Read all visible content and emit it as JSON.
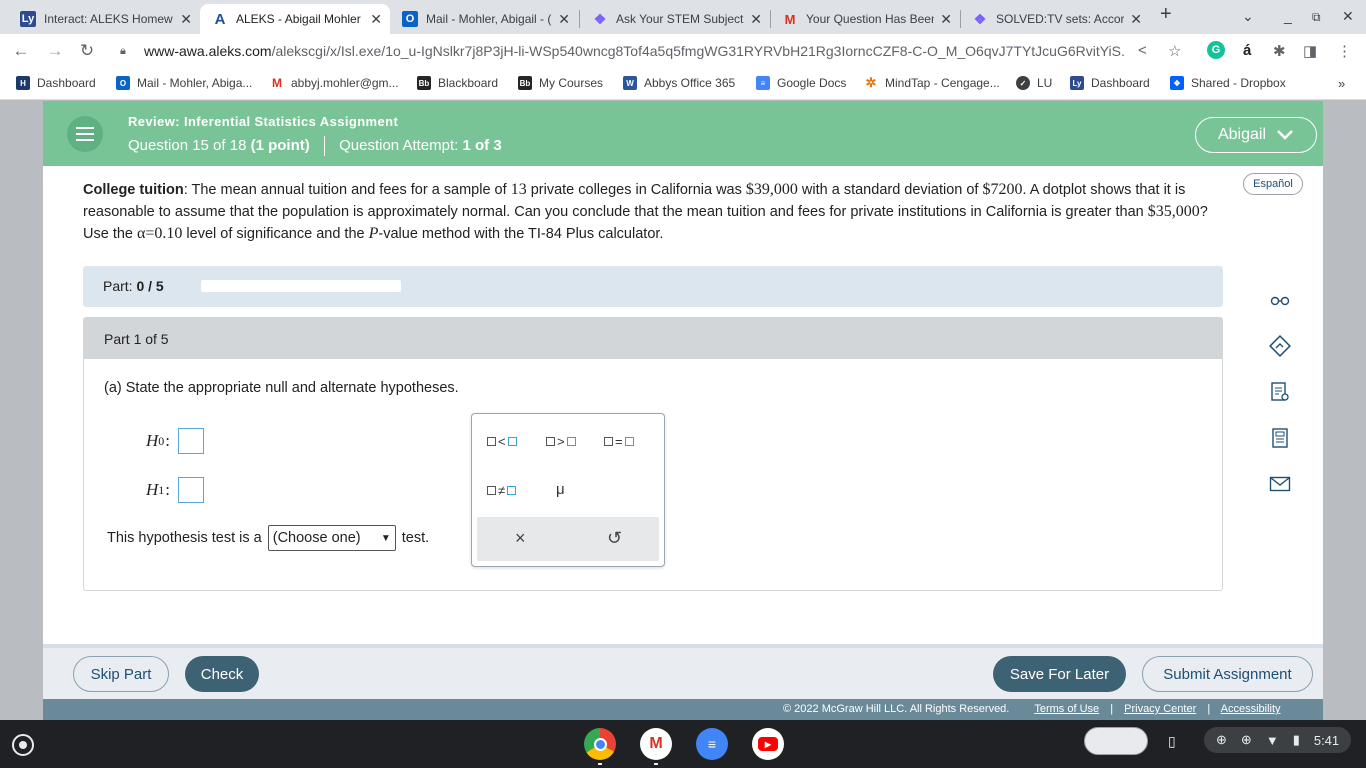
{
  "tabs": [
    {
      "title": "Interact: ALEKS Homew",
      "icon": "aleks-tab-icon"
    },
    {
      "title": "ALEKS - Abigail Mohler",
      "icon": "aleks-a-icon"
    },
    {
      "title": "Mail - Mohler, Abigail - (",
      "icon": "outlook-icon"
    },
    {
      "title": "Ask Your STEM Subject",
      "icon": "chegg-icon"
    },
    {
      "title": "Your Question Has Been",
      "icon": "gmail-icon"
    },
    {
      "title": "SOLVED:TV sets: Accor",
      "icon": "chegg-icon"
    }
  ],
  "url": {
    "host": "www-awa.aleks.com",
    "path": "/alekscgi/x/Isl.exe/1o_u-IgNslkr7j8P3jH-li-WSp540wncg8Tof4a5q5fmgWG31RYRVbH21Rg3IorncCZF8-C-O_M_O6qvJ7TYtJcuG6RvitYiS..."
  },
  "bookmarks": [
    {
      "label": "Dashboard",
      "icon": "dashboard-icon"
    },
    {
      "label": "Mail - Mohler, Abiga...",
      "icon": "outlook-icon"
    },
    {
      "label": "abbyj.mohler@gm...",
      "icon": "gmail-icon"
    },
    {
      "label": "Blackboard",
      "icon": "blackboard-icon"
    },
    {
      "label": "My Courses",
      "icon": "blackboard-icon"
    },
    {
      "label": "Abbys Office 365",
      "icon": "word-icon"
    },
    {
      "label": "Google Docs",
      "icon": "docs-icon"
    },
    {
      "label": "MindTap - Cengage...",
      "icon": "mindtap-icon"
    },
    {
      "label": "LU",
      "icon": "lu-icon"
    },
    {
      "label": "Dashboard",
      "icon": "aleks-tab-icon"
    },
    {
      "label": "Shared - Dropbox",
      "icon": "dropbox-icon"
    }
  ],
  "header": {
    "title": "Review: Inferential Statistics Assignment",
    "question_prefix": "Question 15 of 18",
    "question_points": "(1 point)",
    "attempt_label": "Question Attempt:",
    "attempt_value": "1 of 3",
    "user": "Abigail"
  },
  "language_button": "Español",
  "problem": {
    "topic": "College tuition",
    "t1": ": The mean annual tuition and fees for a sample of ",
    "n": "13",
    "t2": " private colleges in California was ",
    "mean": "$39,000",
    "t3": " with a standard deviation of ",
    "sd": "$7200",
    "t4": ". A dotplot shows that it is reasonable to assume that the population is approximately normal. Can you conclude that the mean tuition and fees for private institutions in California is greater than ",
    "mu0": "$35,000",
    "t5": "? Use the ",
    "alpha": "α=0.10",
    "t6": " level of significance and the ",
    "p": "P",
    "t7": "-value method with the TI-84 Plus calculator."
  },
  "part_progress": {
    "label": "Part:",
    "value": "0 / 5",
    "fraction": 0
  },
  "part": {
    "heading": "Part 1 of 5",
    "instruction": "(a) State the appropriate null and alternate hypotheses.",
    "h0": "H",
    "h0_sub": "0",
    "h1": "H",
    "h1_sub": "1",
    "colon": ":",
    "test_before": "This hypothesis test is a",
    "test_select": "(Choose one)",
    "test_after": "test."
  },
  "palette": {
    "lt": "<",
    "gt": ">",
    "eq": "=",
    "neq": "≠",
    "mu": "μ",
    "clear": "×",
    "undo": "↺"
  },
  "buttons": {
    "skip": "Skip Part",
    "check": "Check",
    "save": "Save For Later",
    "submit": "Submit Assignment"
  },
  "footer": {
    "copyright": "© 2022 McGraw Hill LLC. All Rights Reserved.",
    "terms": "Terms of Use",
    "privacy": "Privacy Center",
    "access": "Accessibility"
  },
  "shelf": {
    "time": "5:41",
    "apps": [
      "chrome-icon",
      "gmail-icon",
      "docs-icon",
      "youtube-icon"
    ]
  },
  "colors": {
    "aleks_green": "#79c497",
    "aleks_navy": "#3d6273",
    "answer_blue": "#5aa6d6"
  }
}
